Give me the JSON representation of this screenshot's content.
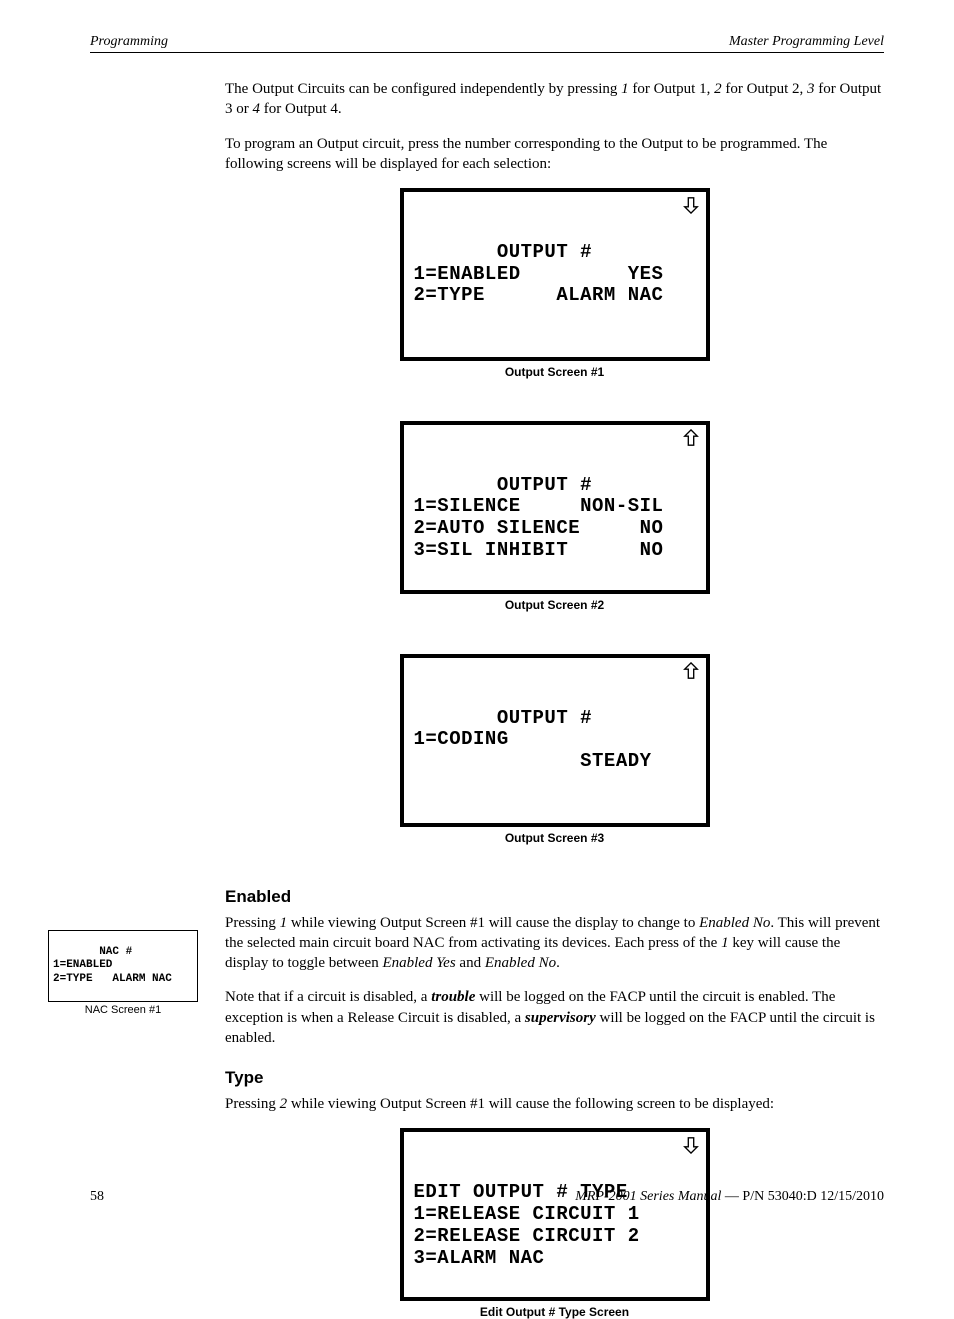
{
  "header": {
    "left": "Programming",
    "right": "Master Programming Level"
  },
  "intro1_a": "The Output Circuits can be configured independently by pressing ",
  "intro1_b": " for Output 1, ",
  "intro1_c": " for Output 2, ",
  "intro1_d": " for Output 3 or ",
  "intro1_e": " for Output 4.",
  "n1": "1",
  "n2": "2",
  "n3": "3",
  "n4": "4",
  "intro2": "To program an Output circuit, press the number corresponding to the Output to be programmed. The following screens will be displayed for each selection:",
  "lcd1": {
    "l1": "       OUTPUT #",
    "l2": "1=ENABLED         YES",
    "l3": "2=TYPE      ALARM NAC",
    "l4": " ",
    "caption": "Output Screen  #1",
    "arrow": "down"
  },
  "lcd2": {
    "l1": "       OUTPUT #",
    "l2": "1=SILENCE     NON-SIL",
    "l3": "2=AUTO SILENCE     NO",
    "l4": "3=SIL INHIBIT      NO",
    "caption": "Output Screen #2",
    "arrow": "up"
  },
  "lcd3": {
    "l1": "       OUTPUT #",
    "l2": "1=CODING",
    "l3": "              STEADY",
    "l4": " ",
    "caption": "Output Screen #3",
    "arrow": "up"
  },
  "sec1": {
    "title": "Enabled",
    "p1a": "Pressing ",
    "p1b": " while viewing Output Screen #1 will cause the display to change to ",
    "p1c": ".  This will prevent the selected main circuit board NAC from activating its devices.  Each press of the ",
    "p1d": " key will cause the display to toggle between ",
    "p1e": " and ",
    "p1f": ".",
    "i_one": "1",
    "i_en_no": "Enabled No",
    "i_en_yes": "Enabled Yes",
    "p2a": "Note that if a circuit is disabled, a ",
    "p2b": " will be logged on the FACP until the circuit is enabled. The exception is when a Release Circuit is disabled, a ",
    "p2c": " will be logged on the FACP until the circuit is enabled.",
    "bi_trouble": "trouble",
    "bi_super": "supervisory"
  },
  "sec2": {
    "title": "Type",
    "p1a": "Pressing ",
    "p1b": " while viewing Output Screen #1 will cause the following screen to be displayed:",
    "i_two": "2"
  },
  "nac": {
    "l1": "       NAC #",
    "l2": "1=ENABLED",
    "l3": "2=TYPE   ALARM NAC",
    "caption": "NAC Screen #1"
  },
  "lcd4": {
    "l1": "EDIT OUTPUT # TYPE",
    "l2": "1=RELEASE CIRCUIT 1",
    "l3": "2=RELEASE CIRCUIT 2",
    "l4": "3=ALARM NAC",
    "caption": "Edit Output # Type Screen",
    "arrow": "down"
  },
  "footer": {
    "page": "58",
    "manual": "MRP-2001 Series Manual",
    "sep": " — ",
    "pn": "P/N 53040:D  12/15/2010"
  }
}
